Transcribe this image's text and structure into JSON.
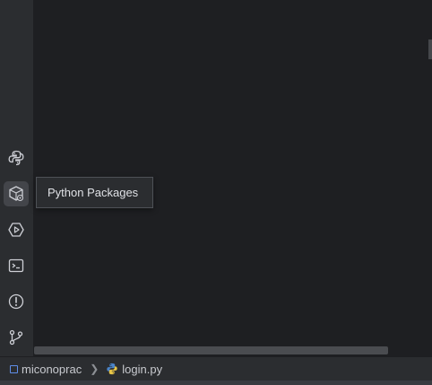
{
  "tooltip": {
    "text": "Python Packages"
  },
  "tool_window_bar": {
    "items": [
      {
        "icon": "python-console-icon"
      },
      {
        "icon": "python-packages-icon",
        "active": true
      },
      {
        "icon": "services-icon"
      },
      {
        "icon": "terminal-icon"
      },
      {
        "icon": "problems-icon"
      },
      {
        "icon": "git-icon"
      }
    ]
  },
  "breadcrumbs": {
    "project": "miconoprac",
    "file": "login.py"
  },
  "colors": {
    "editor_bg": "#1e1f22",
    "panel_bg": "#2b2d30",
    "module_accent": "#5f8ee8"
  }
}
